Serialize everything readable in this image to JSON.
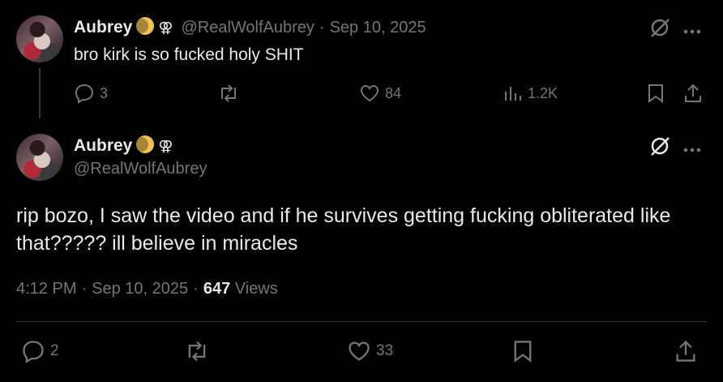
{
  "parent": {
    "name": "Aubrey",
    "badge_symbol": "⚢",
    "handle": "@RealWolfAubrey",
    "separator": "·",
    "date": "Sep 10, 2025",
    "text": "bro kirk is so fucked holy SHIT",
    "replies": "3",
    "likes": "84",
    "views": "1.2K"
  },
  "main": {
    "name": "Aubrey",
    "badge_symbol": "⚢",
    "handle": "@RealWolfAubrey",
    "text": "rip bozo, I saw the video and if he survives getting fucking obliterated like that????? ill believe in miracles",
    "time": "4:12 PM",
    "date": "Sep 10, 2025",
    "separator": "·",
    "views_count": "647",
    "views_label": "Views",
    "replies": "2",
    "likes": "33"
  },
  "icons": {
    "grok": "grok-icon",
    "more": "more-icon",
    "reply": "reply-icon",
    "retweet": "retweet-icon",
    "like": "like-icon",
    "views": "views-icon",
    "bookmark": "bookmark-icon",
    "share": "share-icon"
  },
  "colors": {
    "background": "#000000",
    "text": "#e7e9ea",
    "muted": "#71767b",
    "divider": "#2f3336",
    "badge": "#f2c14e"
  }
}
